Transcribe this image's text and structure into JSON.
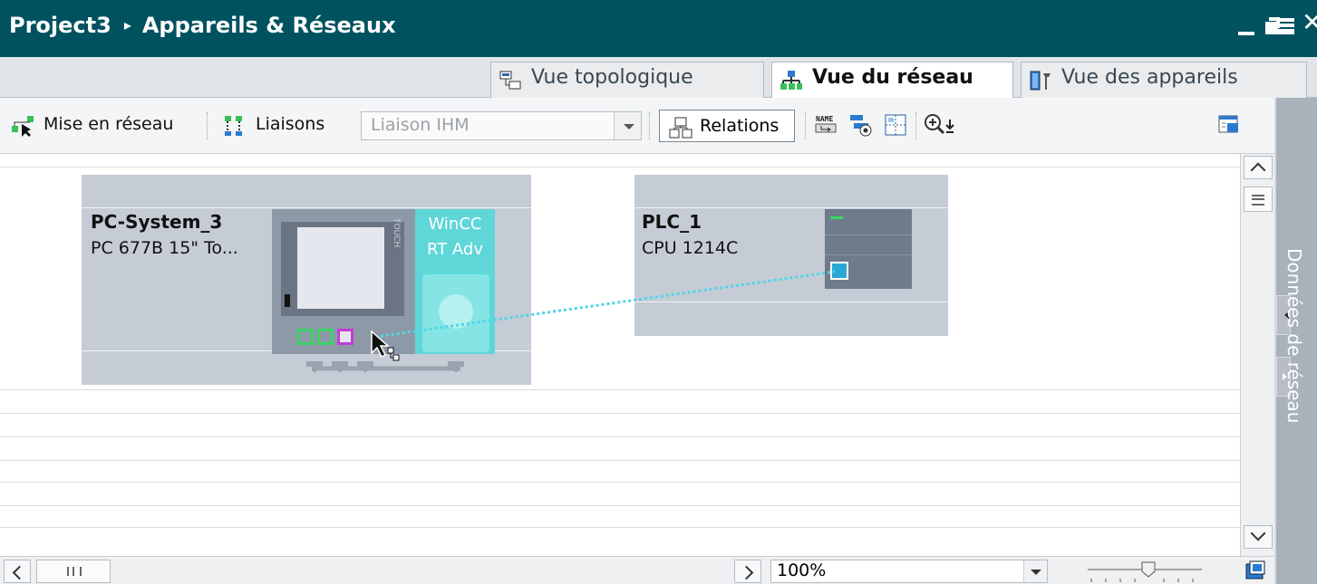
{
  "window": {
    "project": "Project3",
    "breadcrumb_sep": "▸",
    "title": "Appareils & Réseaux"
  },
  "tabs": [
    {
      "label": "Vue topologique",
      "icon": "topology-view-icon",
      "active": false
    },
    {
      "label": "Vue du réseau",
      "icon": "network-view-icon",
      "active": true
    },
    {
      "label": "Vue des appareils",
      "icon": "device-view-icon",
      "active": false
    }
  ],
  "toolbar": {
    "network_label": "Mise en réseau",
    "links_label": "Liaisons",
    "connection_type_value": "Liaison IHM",
    "relations_label": "Relations"
  },
  "devices": {
    "pc": {
      "name": "PC-System_3",
      "type": "PC 677B 15\" To...",
      "hmi_label": "TOUCH",
      "runtime_line1": "WinCC",
      "runtime_line2": "RT Adv"
    },
    "plc": {
      "name": "PLC_1",
      "type": "CPU 1214C"
    }
  },
  "side_panel": {
    "label": "Données de réseau"
  },
  "statusbar": {
    "zoom_value": "100%"
  },
  "colors": {
    "title_bg": "#00525f",
    "device_bg": "#c5ccd6",
    "hmi_connection": "#4fd6e8",
    "wincc_bg": "#5fd6d8",
    "port_green": "#3bd36a",
    "port_selected": "#c23cd8"
  }
}
